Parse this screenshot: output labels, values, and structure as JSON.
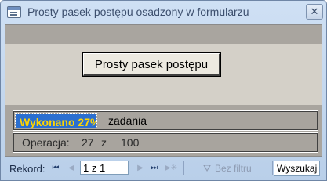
{
  "window": {
    "title": "Prosty pasek postępu osadzony w formularzu",
    "close_glyph": "✕"
  },
  "form": {
    "button_label": "Prosty pasek postępu",
    "progress": {
      "fraction": 0.27,
      "done_text": "Wykonano  27%",
      "task_text": "zadania"
    },
    "operation": {
      "label": "Operacja:",
      "current": "27",
      "separator": "z",
      "total": "100"
    }
  },
  "navigation": {
    "label": "Rekord:",
    "first_glyph": "⏮",
    "prev_glyph": "◀",
    "position": "1 z 1",
    "next_glyph": "▶",
    "last_glyph": "⏭",
    "new_glyph": "▶✳",
    "filter_icon": "funnel-icon",
    "filter_label": "Bez filtru",
    "search_text": "Wyszukaj"
  },
  "colors": {
    "progress_fill": "#2b6fd0",
    "progress_text": "#ffd400"
  }
}
